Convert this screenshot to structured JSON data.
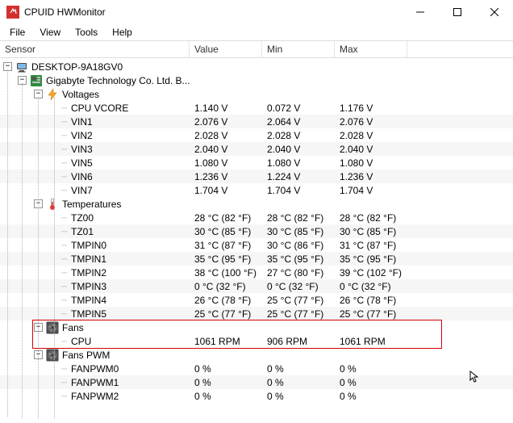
{
  "window": {
    "title": "CPUID HWMonitor"
  },
  "menu": {
    "file": "File",
    "view": "View",
    "tools": "Tools",
    "help": "Help"
  },
  "columns": {
    "sensor": "Sensor",
    "value": "Value",
    "min": "Min",
    "max": "Max"
  },
  "root": {
    "label": "DESKTOP-9A18GV0"
  },
  "mobo": {
    "label": "Gigabyte Technology Co. Ltd. B..."
  },
  "groups": {
    "voltages": "Voltages",
    "temperatures": "Temperatures",
    "fans": "Fans",
    "fanspwm": "Fans PWM"
  },
  "voltages": [
    {
      "name": "CPU VCORE",
      "value": "1.140 V",
      "min": "0.072 V",
      "max": "1.176 V"
    },
    {
      "name": "VIN1",
      "value": "2.076 V",
      "min": "2.064 V",
      "max": "2.076 V"
    },
    {
      "name": "VIN2",
      "value": "2.028 V",
      "min": "2.028 V",
      "max": "2.028 V"
    },
    {
      "name": "VIN3",
      "value": "2.040 V",
      "min": "2.040 V",
      "max": "2.040 V"
    },
    {
      "name": "VIN5",
      "value": "1.080 V",
      "min": "1.080 V",
      "max": "1.080 V"
    },
    {
      "name": "VIN6",
      "value": "1.236 V",
      "min": "1.224 V",
      "max": "1.236 V"
    },
    {
      "name": "VIN7",
      "value": "1.704 V",
      "min": "1.704 V",
      "max": "1.704 V"
    }
  ],
  "temperatures": [
    {
      "name": "TZ00",
      "value": "28 °C  (82 °F)",
      "min": "28 °C  (82 °F)",
      "max": "28 °C  (82 °F)"
    },
    {
      "name": "TZ01",
      "value": "30 °C  (85 °F)",
      "min": "30 °C  (85 °F)",
      "max": "30 °C  (85 °F)"
    },
    {
      "name": "TMPIN0",
      "value": "31 °C  (87 °F)",
      "min": "30 °C  (86 °F)",
      "max": "31 °C  (87 °F)"
    },
    {
      "name": "TMPIN1",
      "value": "35 °C  (95 °F)",
      "min": "35 °C  (95 °F)",
      "max": "35 °C  (95 °F)"
    },
    {
      "name": "TMPIN2",
      "value": "38 °C  (100 °F)",
      "min": "27 °C  (80 °F)",
      "max": "39 °C  (102 °F)"
    },
    {
      "name": "TMPIN3",
      "value": "0 °C  (32 °F)",
      "min": "0 °C  (32 °F)",
      "max": "0 °C  (32 °F)"
    },
    {
      "name": "TMPIN4",
      "value": "26 °C  (78 °F)",
      "min": "25 °C  (77 °F)",
      "max": "26 °C  (78 °F)"
    },
    {
      "name": "TMPIN5",
      "value": "25 °C  (77 °F)",
      "min": "25 °C  (77 °F)",
      "max": "25 °C  (77 °F)"
    }
  ],
  "fans": [
    {
      "name": "CPU",
      "value": "1061 RPM",
      "min": "906 RPM",
      "max": "1061 RPM"
    }
  ],
  "fanspwm": [
    {
      "name": "FANPWM0",
      "value": "0 %",
      "min": "0 %",
      "max": "0 %"
    },
    {
      "name": "FANPWM1",
      "value": "0 %",
      "min": "0 %",
      "max": "0 %"
    },
    {
      "name": "FANPWM2",
      "value": "0 %",
      "min": "0 %",
      "max": "0 %"
    }
  ]
}
